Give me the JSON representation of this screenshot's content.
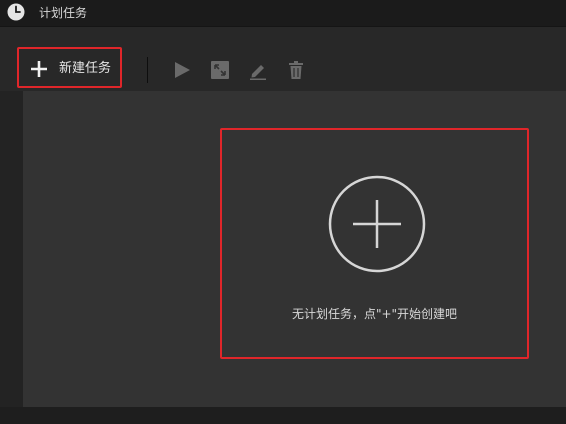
{
  "window": {
    "title": "计划任务",
    "title_icon": "clock-icon"
  },
  "toolbar": {
    "new_task_label": "新建任务",
    "new_task_icon": "plus-icon",
    "icons": [
      "play-icon",
      "expand-icon",
      "edit-icon",
      "trash-icon"
    ]
  },
  "empty_state": {
    "icon": "add-circle-icon",
    "message": "无计划任务，点\"+\"开始创建吧"
  },
  "colors": {
    "highlight_border": "#e0262a",
    "background": "#333333",
    "titlebar": "#1b1b1b",
    "text": "#d8d8d8",
    "disabled_icon": "#6a6a6a"
  }
}
